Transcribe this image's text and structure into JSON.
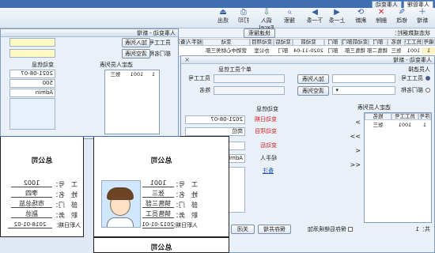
{
  "app": {
    "tab": "人事管理",
    "tab2": "人事变动"
  },
  "toolbar": {
    "items": [
      {
        "label": "新增",
        "icon": "＋"
      },
      {
        "label": "修改",
        "icon": "✎"
      },
      {
        "label": "删除",
        "icon": "✕"
      },
      {
        "label": "刷新",
        "icon": "⟳"
      },
      {
        "label": "上一条",
        "icon": "◀"
      },
      {
        "label": "下一条",
        "icon": "▶"
      },
      {
        "label": "搜索",
        "icon": "⌕"
      },
      {
        "label": "调入Excel",
        "icon": "⇩"
      },
      {
        "label": "打印",
        "icon": "⎙"
      },
      {
        "label": "退出",
        "icon": "⏏"
      }
    ]
  },
  "filter": {
    "label": "状态或数据栏：",
    "quick_search": "快速搜索"
  },
  "grid": {
    "headers": [
      "编号",
      "员工工号",
      "姓名",
      "部门",
      "变动前部门",
      "部门",
      "变动前",
      "变动后",
      "变动项目",
      "变动",
      "经手人",
      "备注"
    ],
    "row": [
      "1",
      "1001",
      "张三",
      "销售二部",
      "销售三部",
      "部门",
      "2020-11-04",
      "部门",
      "办公室",
      "营销中心财务三部",
      ""
    ]
  },
  "window": {
    "title": "人事变动 - 新增"
  },
  "person": {
    "section": "人员选择",
    "opt_staff": "员工工号",
    "opt_dept": "部门名称",
    "add_btn": "加入列表",
    "remove_btn": "清空列表",
    "single_section": "单个员工信息",
    "staff_no": "员工工号",
    "name": "姓名"
  },
  "change": {
    "section": "变动信息",
    "date_label": "变动日期",
    "date": "2021-08-07",
    "item_label": "变动项目",
    "item": "岗位",
    "after_label": "变动后",
    "handler_label": "经手人",
    "handler": "Admin",
    "remark_label": "备注"
  },
  "list": {
    "title": "选定人员列表",
    "headers": [
      "序号",
      "员工工号",
      "姓名"
    ],
    "rows": [
      [
        "1",
        "1001",
        "张三"
      ]
    ],
    "arrows": [
      ">",
      ">>",
      "<",
      "<<"
    ]
  },
  "footer": {
    "save": "保存并增",
    "close": "关闭",
    "continue": "保存后继续添加",
    "count": "共：1"
  },
  "cards": [
    {
      "company": "总公司",
      "rows": [
        {
          "k": "工　号：",
          "v": "1001"
        },
        {
          "k": "姓　名：",
          "v": "张三"
        },
        {
          "k": "部　门：",
          "v": "销售三部"
        },
        {
          "k": "职　务：",
          "v": "销售员工"
        },
        {
          "k": "入职日期：",
          "v": "2012-01-01"
        }
      ]
    },
    {
      "company": "总公司",
      "rows": [
        {
          "k": "工　号：",
          "v": "1002"
        },
        {
          "k": "姓　名：",
          "v": "李四"
        },
        {
          "k": "部　门：",
          "v": "市场总监"
        },
        {
          "k": "职　务：",
          "v": "副总"
        },
        {
          "k": "入职日期：",
          "v": "2018-01-02"
        }
      ]
    },
    {
      "company": "总公司"
    }
  ],
  "small": {
    "title": "人事变动 - 新增",
    "staff_no": "员工工号",
    "dept": "部门名称",
    "add": "加入列表",
    "remove": "清空列表",
    "change_title": "变动信息",
    "date": "2021-08-07",
    "count": "500",
    "handler": "Admin",
    "list_title": "选定人员列表",
    "row": [
      "1",
      "1001",
      "张三"
    ]
  },
  "colors": {
    "accent": "#2e5e9c",
    "window_bg": "#dfe8f3",
    "required": "#d21f1f"
  }
}
